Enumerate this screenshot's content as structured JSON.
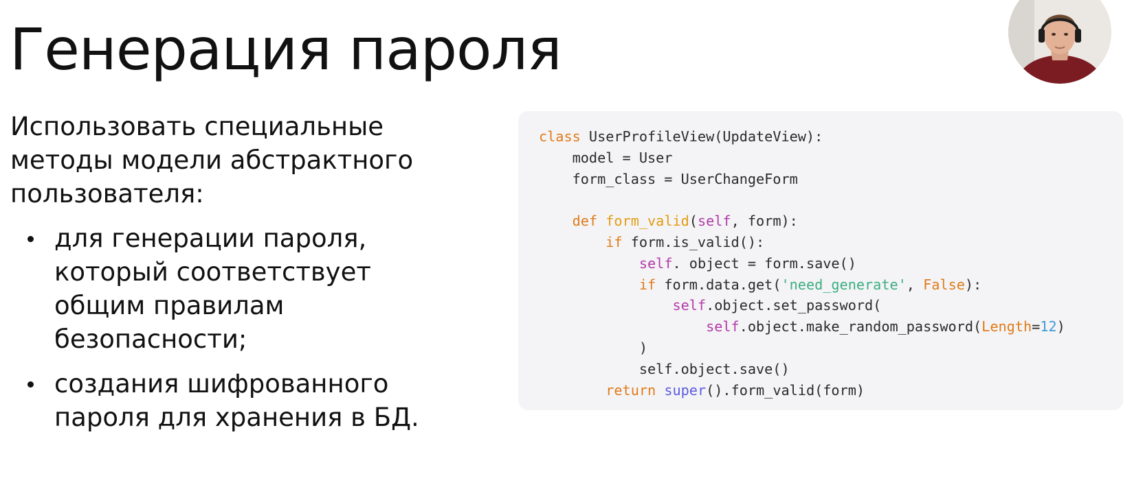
{
  "slide": {
    "title": "Генерация пароля",
    "intro_lines": [
      "Использовать специальные",
      "методы модели абстрактного",
      "пользователя:"
    ],
    "bullets": [
      {
        "lines": [
          "для генерации пароля,",
          "который соответствует",
          "общим правилам",
          "безопасности;"
        ]
      },
      {
        "lines": [
          "создания шифрованного",
          "пароля для хранения в БД."
        ]
      }
    ]
  },
  "code": {
    "tokens": [
      "class",
      " UserProfileView(UpdateView):",
      "    model = User",
      "    form_class = UserChangeForm",
      "    ",
      "def",
      " ",
      "form_valid",
      "(",
      "self",
      ", form):",
      "        ",
      "if",
      " form.is_valid():",
      "            ",
      "self",
      ". object = form.save()",
      "            ",
      "if",
      " form.data.get(",
      "'need_generate'",
      ", ",
      "False",
      "):",
      "                ",
      "self",
      ".object.set_password(",
      "                    ",
      "self",
      ".object.make_random_password(",
      "Length",
      "=",
      "12",
      ")",
      "            )",
      "            self.object.save()",
      "        ",
      "return",
      " ",
      "super",
      "().form_valid(form)"
    ],
    "colors": {
      "keyword": "#e07b1a",
      "function_name": "#e39c12",
      "self": "#b23aa8",
      "string": "#3bae80",
      "number": "#3f9ad8",
      "builtin": "#5b5be0",
      "default": "#2a2a2a",
      "panel_background": "#f4f4f6"
    }
  },
  "presenter": {
    "icon": "presenter-webcam-avatar"
  }
}
